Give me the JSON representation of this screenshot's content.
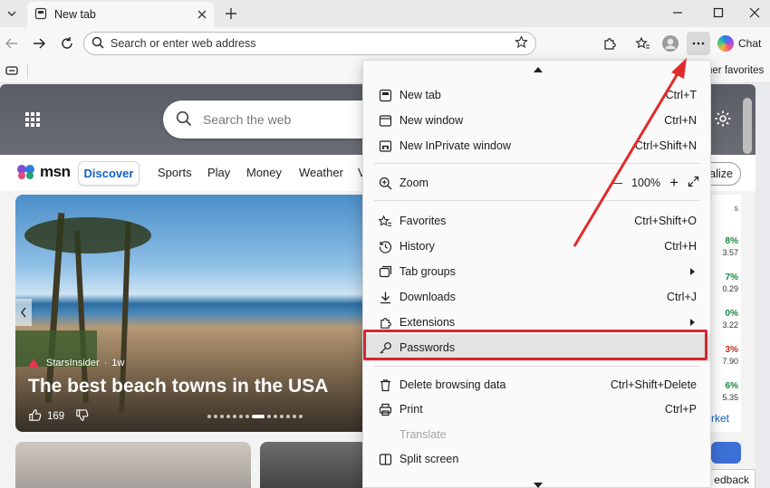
{
  "browser": {
    "tab_title": "New tab",
    "address_placeholder": "Search or enter web address",
    "chat_label": "Chat",
    "other_favorites": "her favorites"
  },
  "newtab": {
    "search_placeholder": "Search the web",
    "logo_text": "msn",
    "nav": [
      "Discover",
      "Sports",
      "Play",
      "Money",
      "Weather",
      "V"
    ],
    "personalize_label": "alize",
    "news": {
      "source": "StarsInsider",
      "age": "1w",
      "title": "The best beach towns in the USA",
      "likes": "169"
    },
    "markets": [
      {
        "pct": "8%",
        "val": "3.57",
        "up": true
      },
      {
        "pct": "7%",
        "val": "0.29",
        "up": true
      },
      {
        "pct": "0%",
        "val": "3.22",
        "up": true
      },
      {
        "pct": "3%",
        "val": "7.90",
        "up": false
      },
      {
        "pct": "6%",
        "val": "5.35",
        "up": true
      }
    ],
    "markets_link": "rket",
    "top_peek": "s",
    "feedback_label": "edback"
  },
  "menu": {
    "new_tab": {
      "label": "New tab",
      "shortcut": "Ctrl+T"
    },
    "new_window": {
      "label": "New window",
      "shortcut": "Ctrl+N"
    },
    "new_inprivate": {
      "label": "New InPrivate window",
      "shortcut": "Ctrl+Shift+N"
    },
    "zoom": {
      "label": "Zoom",
      "value": "100%",
      "minus": "—",
      "plus": "+"
    },
    "favorites": {
      "label": "Favorites",
      "shortcut": "Ctrl+Shift+O"
    },
    "history": {
      "label": "History",
      "shortcut": "Ctrl+H"
    },
    "tab_groups": {
      "label": "Tab groups"
    },
    "downloads": {
      "label": "Downloads",
      "shortcut": "Ctrl+J"
    },
    "extensions": {
      "label": "Extensions"
    },
    "passwords": {
      "label": "Passwords"
    },
    "delete_browsing": {
      "label": "Delete browsing data",
      "shortcut": "Ctrl+Shift+Delete"
    },
    "print": {
      "label": "Print",
      "shortcut": "Ctrl+P"
    },
    "translate": {
      "label": "Translate"
    },
    "split_screen": {
      "label": "Split screen"
    }
  },
  "colors": {
    "highlight_box": "#d7262f",
    "annotation_arrow": "#e02b2b",
    "link_blue": "#1062c4"
  }
}
